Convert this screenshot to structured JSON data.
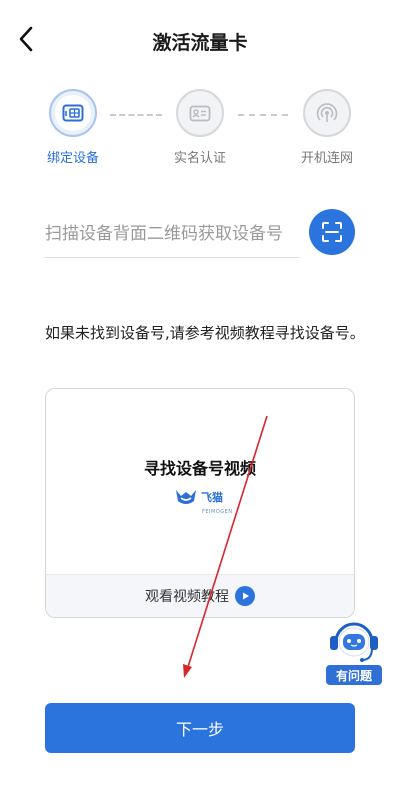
{
  "header": {
    "title": "激活流量卡",
    "back_icon": "chevron-left-icon"
  },
  "steps": [
    {
      "label": "绑定设备",
      "state": "active",
      "icon": "sim-card-icon"
    },
    {
      "label": "实名认证",
      "state": "inactive",
      "icon": "id-card-icon"
    },
    {
      "label": "开机连网",
      "state": "inactive",
      "icon": "wifi-signal-icon"
    }
  ],
  "device_field": {
    "value": "",
    "placeholder": "扫描设备背面二维码获取设备号",
    "scan_icon": "scan-icon"
  },
  "help_text": "如果未找到设备号,请参考视频教程寻找设备号。",
  "video_card": {
    "title": "寻找设备号视频",
    "logo_text": "飞猫",
    "logo_subtext": "FEIMOGEN",
    "watch_label": "观看视频教程",
    "play_icon": "play-icon"
  },
  "help_bot": {
    "label": "有问题",
    "icon": "robot-assistant-icon"
  },
  "next_button": {
    "label": "下一步"
  },
  "colors": {
    "primary": "#2b74de",
    "active_step": "#2a6fd9",
    "inactive": "#c8cace",
    "annotation_arrow": "#d9262a"
  }
}
